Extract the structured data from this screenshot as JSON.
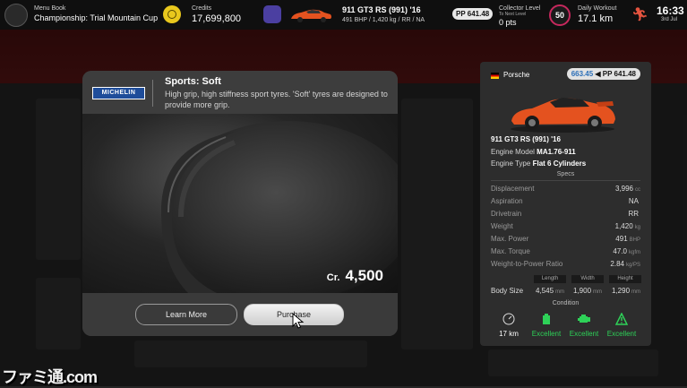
{
  "topbar": {
    "menu_book_label": "Menu Book",
    "menu_book_value": "Championship: Trial Mountain Cup",
    "credits_label": "Credits",
    "credits_value": "17,699,800",
    "car_name": "911 GT3 RS (991) '16",
    "car_specs": "491 BHP / 1,420 kg / RR / NA",
    "car_pp": "PP 641.48",
    "collector_label": "Collector Level",
    "collector_next": "To Next Level",
    "collector_pts": "0 pts",
    "collector_level": "50",
    "workout_label": "Daily Workout",
    "workout_value": "17.1 km",
    "time": "16:33",
    "date": "3rd Jul"
  },
  "dialog": {
    "brand": "MICHELIN",
    "title": "Sports: Soft",
    "description": "High grip, high stiffness sport tyres. 'Soft' tyres are designed to provide more grip.",
    "price_prefix": "Cr.",
    "price": "4,500",
    "learn_more": "Learn More",
    "purchase": "Purchase"
  },
  "panel": {
    "maker": "Porsche",
    "pp_before": "663.45",
    "pp_arrow": "◀",
    "pp_after": "PP 641.48",
    "car_name": "911 GT3 RS (991) '16",
    "engine_model_label": "Engine Model",
    "engine_model": "MA1.76-911",
    "engine_type_label": "Engine Type",
    "engine_type": "Flat 6 Cylinders",
    "specs_header": "Specs",
    "specs": [
      {
        "label": "Displacement",
        "value": "3,996",
        "unit": "cc"
      },
      {
        "label": "Aspiration",
        "value": "NA",
        "unit": ""
      },
      {
        "label": "Drivetrain",
        "value": "RR",
        "unit": ""
      },
      {
        "label": "Weight",
        "value": "1,420",
        "unit": "kg"
      },
      {
        "label": "Max. Power",
        "value": "491",
        "unit": "BHP"
      },
      {
        "label": "Max. Torque",
        "value": "47.0",
        "unit": "kgfm"
      },
      {
        "label": "Weight-to-Power Ratio",
        "value": "2.84",
        "unit": "kg/PS"
      }
    ],
    "dim_headers": [
      "Length",
      "Width",
      "Height"
    ],
    "body_size_label": "Body Size",
    "body_size": [
      {
        "value": "4,545",
        "unit": "mm"
      },
      {
        "value": "1,900",
        "unit": "mm"
      },
      {
        "value": "1,290",
        "unit": "mm"
      }
    ],
    "condition_header": "Condition",
    "condition": [
      {
        "icon": "odometer-icon",
        "value": "17 km"
      },
      {
        "icon": "oil-icon",
        "value": "Excellent"
      },
      {
        "icon": "engine-icon",
        "value": "Excellent"
      },
      {
        "icon": "warning-icon",
        "value": "Excellent"
      }
    ]
  },
  "watermark": "ファミ通.com",
  "colors": {
    "accent_green": "#2ed158",
    "level_ring": "#c6285d",
    "credit_gold": "#e9c81d",
    "car_orange": "#e4521f"
  }
}
